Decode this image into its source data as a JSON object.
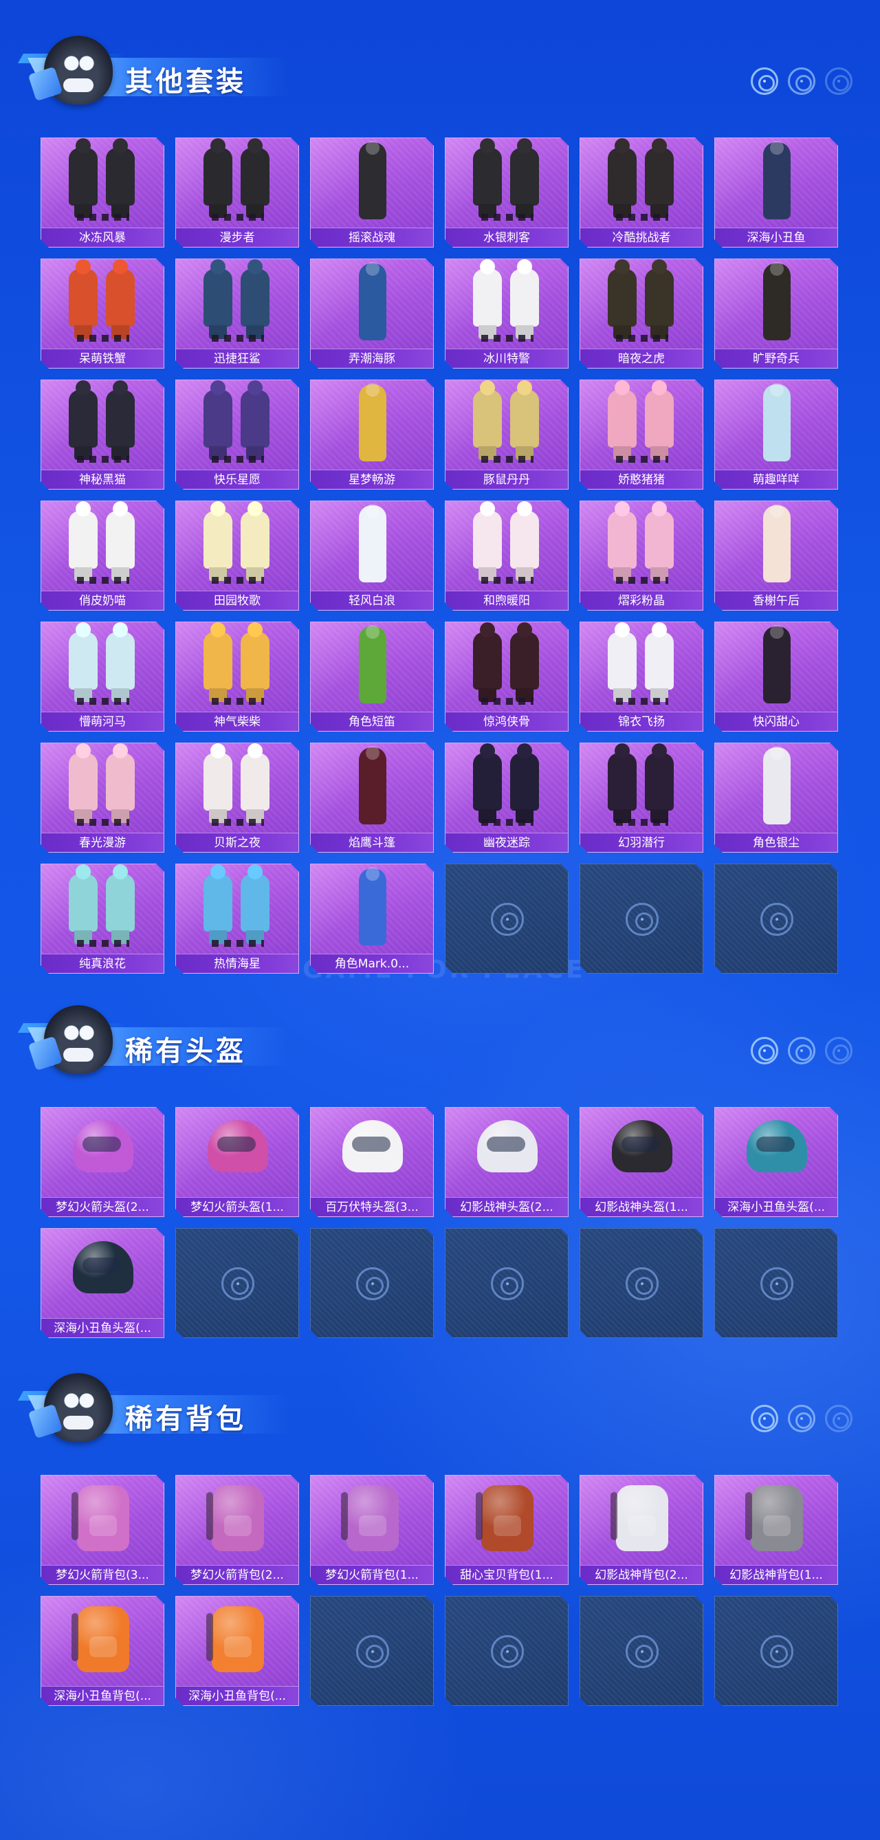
{
  "watermark": "GAME FOR PEACE",
  "sections": [
    {
      "title": "其他套装",
      "items": [
        {
          "label": "冰冻风暴",
          "icon": "outfit-icon",
          "color": "#2b2a30"
        },
        {
          "label": "漫步者",
          "icon": "outfit-icon",
          "color": "#2a2a2e"
        },
        {
          "label": "摇滚战魂",
          "icon": "outfit-icon",
          "color": "#2d2c30"
        },
        {
          "label": "水银刺客",
          "icon": "outfit-icon",
          "color": "#2c2b2f"
        },
        {
          "label": "冷酷挑战者",
          "icon": "outfit-icon",
          "color": "#2f2a2b"
        },
        {
          "label": "深海小丑鱼",
          "icon": "outfit-icon",
          "color": "#2c3a62"
        },
        {
          "label": "呆萌铁蟹",
          "icon": "outfit-icon",
          "color": "#d8502c"
        },
        {
          "label": "迅捷狂鲨",
          "icon": "outfit-icon",
          "color": "#2d4d74"
        },
        {
          "label": "弄潮海豚",
          "icon": "outfit-icon",
          "color": "#2b5aa0"
        },
        {
          "label": "冰川特警",
          "icon": "outfit-icon",
          "color": "#f1f1f4"
        },
        {
          "label": "暗夜之虎",
          "icon": "outfit-icon",
          "color": "#3a3328"
        },
        {
          "label": "旷野奇兵",
          "icon": "outfit-icon",
          "color": "#2e2b26"
        },
        {
          "label": "神秘黑猫",
          "icon": "outfit-icon",
          "color": "#2a2a38"
        },
        {
          "label": "快乐星愿",
          "icon": "outfit-icon",
          "color": "#4a3a88"
        },
        {
          "label": "星梦畅游",
          "icon": "outfit-icon",
          "color": "#e0b540"
        },
        {
          "label": "豚鼠丹丹",
          "icon": "outfit-icon",
          "color": "#d9c27a"
        },
        {
          "label": "娇憨猪猪",
          "icon": "outfit-icon",
          "color": "#f0a7c0"
        },
        {
          "label": "萌趣咩咩",
          "icon": "outfit-icon",
          "color": "#bfe0ee"
        },
        {
          "label": "俏皮奶喵",
          "icon": "outfit-icon",
          "color": "#f2f2f2"
        },
        {
          "label": "田园牧歌",
          "icon": "outfit-icon",
          "color": "#f4ecc0"
        },
        {
          "label": "轻风白浪",
          "icon": "outfit-icon",
          "color": "#eef3fa"
        },
        {
          "label": "和煦暖阳",
          "icon": "outfit-icon",
          "color": "#f6e6ee"
        },
        {
          "label": "熠彩粉晶",
          "icon": "outfit-icon",
          "color": "#f3b6d2"
        },
        {
          "label": "香榭午后",
          "icon": "outfit-icon",
          "color": "#f3e2d5"
        },
        {
          "label": "懵萌河马",
          "icon": "outfit-icon",
          "color": "#cfe9f2"
        },
        {
          "label": "神气柴柴",
          "icon": "outfit-icon",
          "color": "#f0b64a"
        },
        {
          "label": "角色短笛",
          "icon": "outfit-icon",
          "color": "#5ea83a"
        },
        {
          "label": "惊鸿侠骨",
          "icon": "outfit-icon",
          "color": "#3a1f28"
        },
        {
          "label": "锦衣飞扬",
          "icon": "outfit-icon",
          "color": "#efeff5"
        },
        {
          "label": "快闪甜心",
          "icon": "outfit-icon",
          "color": "#2a2230"
        },
        {
          "label": "春光漫游",
          "icon": "outfit-icon",
          "color": "#f0bccd"
        },
        {
          "label": "贝斯之夜",
          "icon": "outfit-icon",
          "color": "#f1eaea"
        },
        {
          "label": "焰鹰斗篷",
          "icon": "outfit-icon",
          "color": "#5a1e2a"
        },
        {
          "label": "幽夜迷踪",
          "icon": "outfit-icon",
          "color": "#241f38"
        },
        {
          "label": "幻羽潜行",
          "icon": "outfit-icon",
          "color": "#2a1f36"
        },
        {
          "label": "角色银尘",
          "icon": "outfit-icon",
          "color": "#e9e9ef"
        },
        {
          "label": "纯真浪花",
          "icon": "outfit-icon",
          "color": "#8ed4d8"
        },
        {
          "label": "热情海星",
          "icon": "outfit-icon",
          "color": "#5fb8e8"
        },
        {
          "label": "角色Mark.0...",
          "icon": "outfit-icon",
          "color": "#3a6ad8"
        }
      ],
      "empty_slots": 3
    },
    {
      "title": "稀有头盔",
      "items": [
        {
          "label": "梦幻火箭头盔(2...",
          "icon": "helmet-icon",
          "color": "#c25ad8"
        },
        {
          "label": "梦幻火箭头盔(1...",
          "icon": "helmet-icon",
          "color": "#d04fa8"
        },
        {
          "label": "百万伏特头盔(3...",
          "icon": "helmet-icon",
          "color": "#f3f3f5"
        },
        {
          "label": "幻影战神头盔(2...",
          "icon": "helmet-icon",
          "color": "#e8e8f0"
        },
        {
          "label": "幻影战神头盔(1...",
          "icon": "helmet-icon",
          "color": "#2a2a30"
        },
        {
          "label": "深海小丑鱼头盔(...",
          "icon": "helmet-icon",
          "color": "#2f8fa8"
        },
        {
          "label": "深海小丑鱼头盔(...",
          "icon": "helmet-icon",
          "color": "#1f2f40"
        }
      ],
      "empty_slots": 5
    },
    {
      "title": "稀有背包",
      "items": [
        {
          "label": "梦幻火箭背包(3...",
          "icon": "backpack-icon",
          "color": "#d070c8"
        },
        {
          "label": "梦幻火箭背包(2...",
          "icon": "backpack-icon",
          "color": "#c468c0"
        },
        {
          "label": "梦幻火箭背包(1...",
          "icon": "backpack-icon",
          "color": "#b868cc"
        },
        {
          "label": "甜心宝贝背包(1...",
          "icon": "backpack-icon",
          "color": "#b04a2a"
        },
        {
          "label": "幻影战神背包(2...",
          "icon": "backpack-icon",
          "color": "#e6e6ee"
        },
        {
          "label": "幻影战神背包(1...",
          "icon": "backpack-icon",
          "color": "#8a8a92"
        },
        {
          "label": "深海小丑鱼背包(...",
          "icon": "backpack-icon",
          "color": "#f07a2a"
        },
        {
          "label": "深海小丑鱼背包(...",
          "icon": "backpack-icon",
          "color": "#f28030"
        }
      ],
      "empty_slots": 4
    }
  ]
}
